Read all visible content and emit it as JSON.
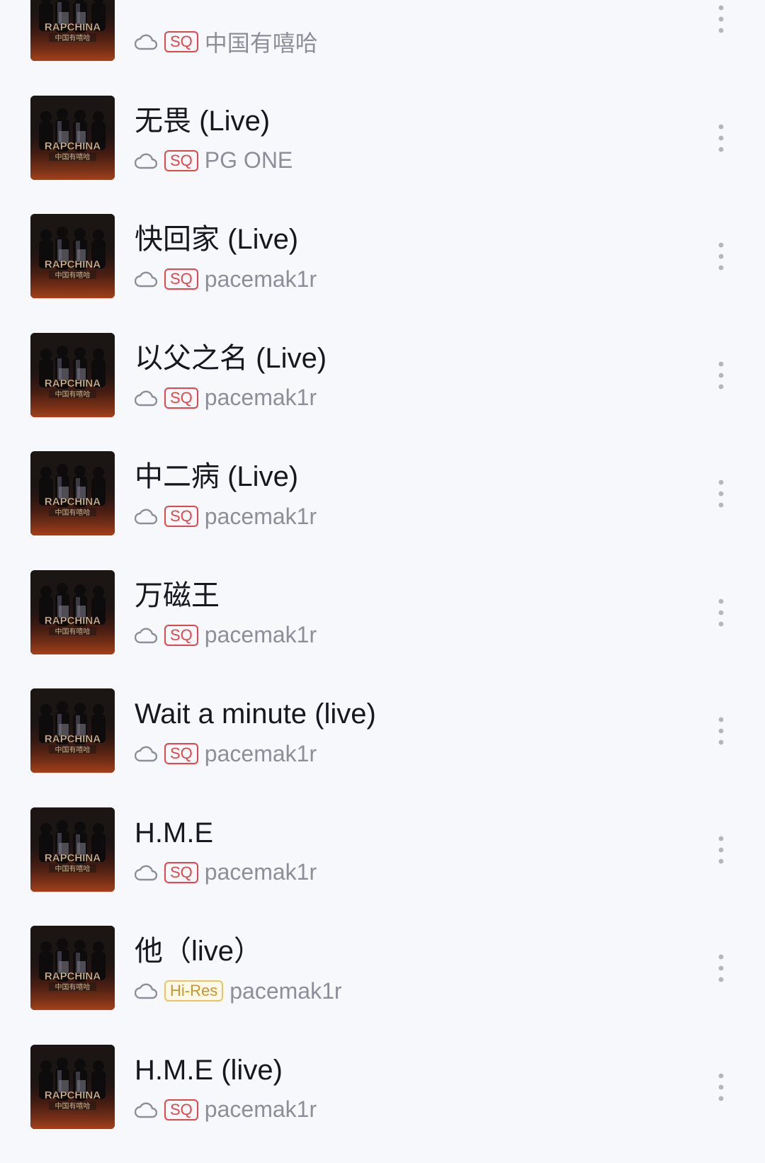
{
  "songs": [
    {
      "title": "",
      "quality": "SQ",
      "artist": "中国有嘻哈"
    },
    {
      "title": "无畏 (Live)",
      "quality": "SQ",
      "artist": "PG ONE"
    },
    {
      "title": "快回家 (Live)",
      "quality": "SQ",
      "artist": "pacemak1r"
    },
    {
      "title": "以父之名 (Live)",
      "quality": "SQ",
      "artist": "pacemak1r"
    },
    {
      "title": "中二病 (Live)",
      "quality": "SQ",
      "artist": "pacemak1r"
    },
    {
      "title": "万磁王",
      "quality": "SQ",
      "artist": "pacemak1r"
    },
    {
      "title": "Wait a minute (live)",
      "quality": "SQ",
      "artist": "pacemak1r"
    },
    {
      "title": "H.M.E",
      "quality": "SQ",
      "artist": "pacemak1r"
    },
    {
      "title": "他（live）",
      "quality": "Hi-Res",
      "artist": "pacemak1r"
    },
    {
      "title": "H.M.E (live)",
      "quality": "SQ",
      "artist": "pacemak1r"
    }
  ],
  "cover": {
    "logo_text": "RAPCHINA",
    "sub_text": "中国有嘻哈"
  },
  "icons": {
    "cloud": "cloud-icon",
    "more": "more-vertical-icon"
  },
  "colors": {
    "sq_badge": "#e0484c",
    "hires_badge": "#c8962a",
    "title": "#161820",
    "artist": "#8c8f99",
    "background": "#f7f8fc"
  }
}
